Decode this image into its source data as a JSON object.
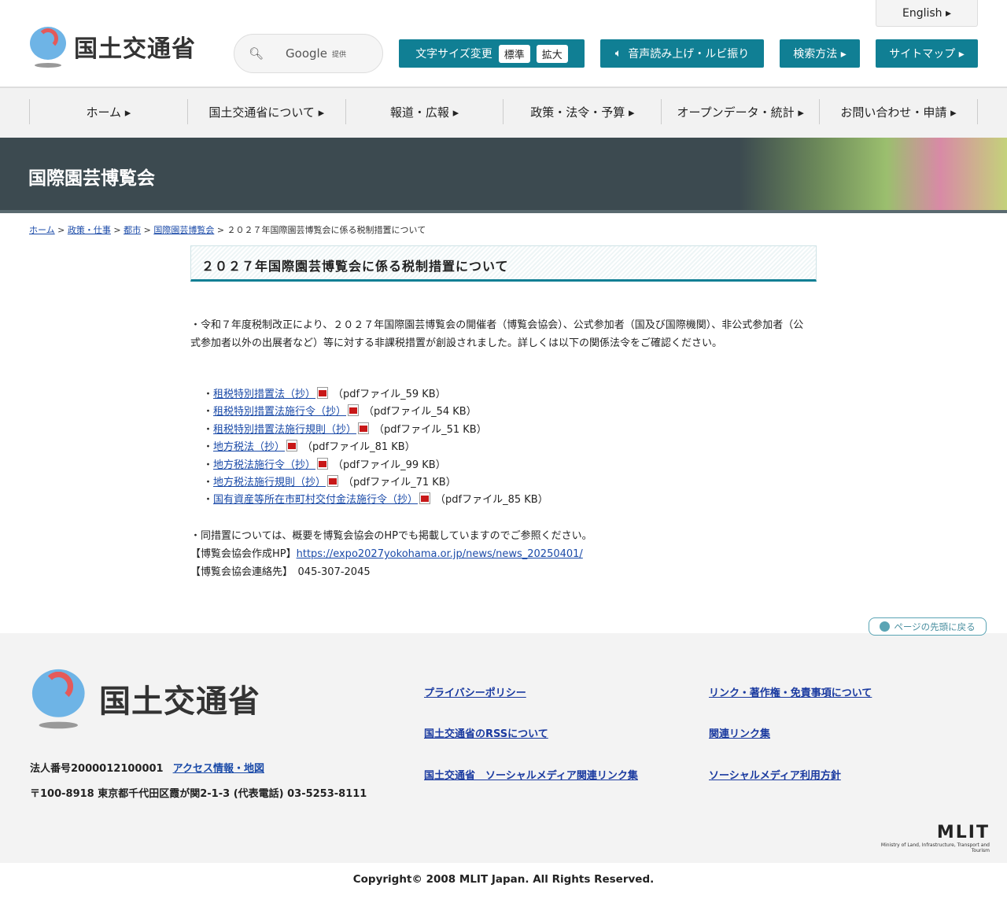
{
  "header": {
    "logo_text": "国土交通省",
    "search_brand": "Google",
    "search_suffix": "提供",
    "english": "English ▸",
    "font_size_label": "文字サイズ変更",
    "font_standard": "標準",
    "font_large": "拡大",
    "voice": "音声読み上げ・ルビ振り",
    "search_method": "検索方法 ▸",
    "sitemap": "サイトマップ ▸"
  },
  "nav": [
    "ホーム ▸",
    "国土交通省について ▸",
    "報道・広報 ▸",
    "政策・法令・予算 ▸",
    "オープンデータ・統計 ▸",
    "お問い合わせ・申請 ▸"
  ],
  "banner_title": "国際園芸博覧会",
  "breadcrumb": {
    "items": [
      "ホーム",
      "政策・仕事",
      "都市",
      "国際園芸博覧会"
    ],
    "current": "２０２７年国際園芸博覧会に係る税制措置について",
    "sep": ">"
  },
  "page_title": "２０２７年国際園芸博覧会に係る税制措置について",
  "intro": "・令和７年度税制改正により、２０２７年国際園芸博覧会の開催者（博覧会協会）、公式参加者（国及び国際機関）、非公式参加者（公式参加者以外の出展者など）等に対する非課税措置が創設されました。詳しくは以下の関係法令をご確認ください。",
  "documents": [
    {
      "label": "租税特別措置法（抄）",
      "size": "（pdfファイル_59 KB）"
    },
    {
      "label": "租税特別措置法施行令（抄）",
      "size": "（pdfファイル_54 KB）"
    },
    {
      "label": "租税特別措置法施行規則（抄）",
      "size": "（pdfファイル_51 KB）"
    },
    {
      "label": "地方税法（抄）",
      "size": "（pdfファイル_81 KB）"
    },
    {
      "label": "地方税法施行令（抄）",
      "size": "（pdfファイル_99 KB）"
    },
    {
      "label": "地方税法施行規則（抄）",
      "size": "（pdfファイル_71 KB）"
    },
    {
      "label": "国有資産等所在市町村交付金法施行令（抄）",
      "size": "（pdfファイル_85 KB）"
    }
  ],
  "notes": {
    "line1": "・同措置については、概要を博覧会協会のHPでも掲載していますのでご参照ください。",
    "hp_label": "【博覧会協会作成HP】",
    "hp_url": "https://expo2027yokohama.or.jp/news/news_20250401/",
    "contact_label": "【博覧会協会連絡先】",
    "contact_tel": "045-307-2045"
  },
  "back_to_top": "ページの先頭に戻る",
  "footer": {
    "logo_text": "国土交通省",
    "corp_no": "法人番号2000012100001",
    "access": "アクセス情報・地図",
    "address": "〒100-8918 東京都千代田区霞が関2-1-3 (代表電話) 03-5253-8111",
    "links": [
      "プライバシーポリシー",
      "リンク・著作権・免責事項について",
      "国土交通省のRSSについて",
      "関連リンク集",
      "国土交通省　ソーシャルメディア関連リンク集",
      "ソーシャルメディア利用方針"
    ],
    "mlit": "MLIT",
    "mlit_sub": "Ministry of Land, Infrastructure, Transport and Tourism",
    "copyright": "Copyright© 2008 MLIT Japan. All Rights Reserved."
  }
}
